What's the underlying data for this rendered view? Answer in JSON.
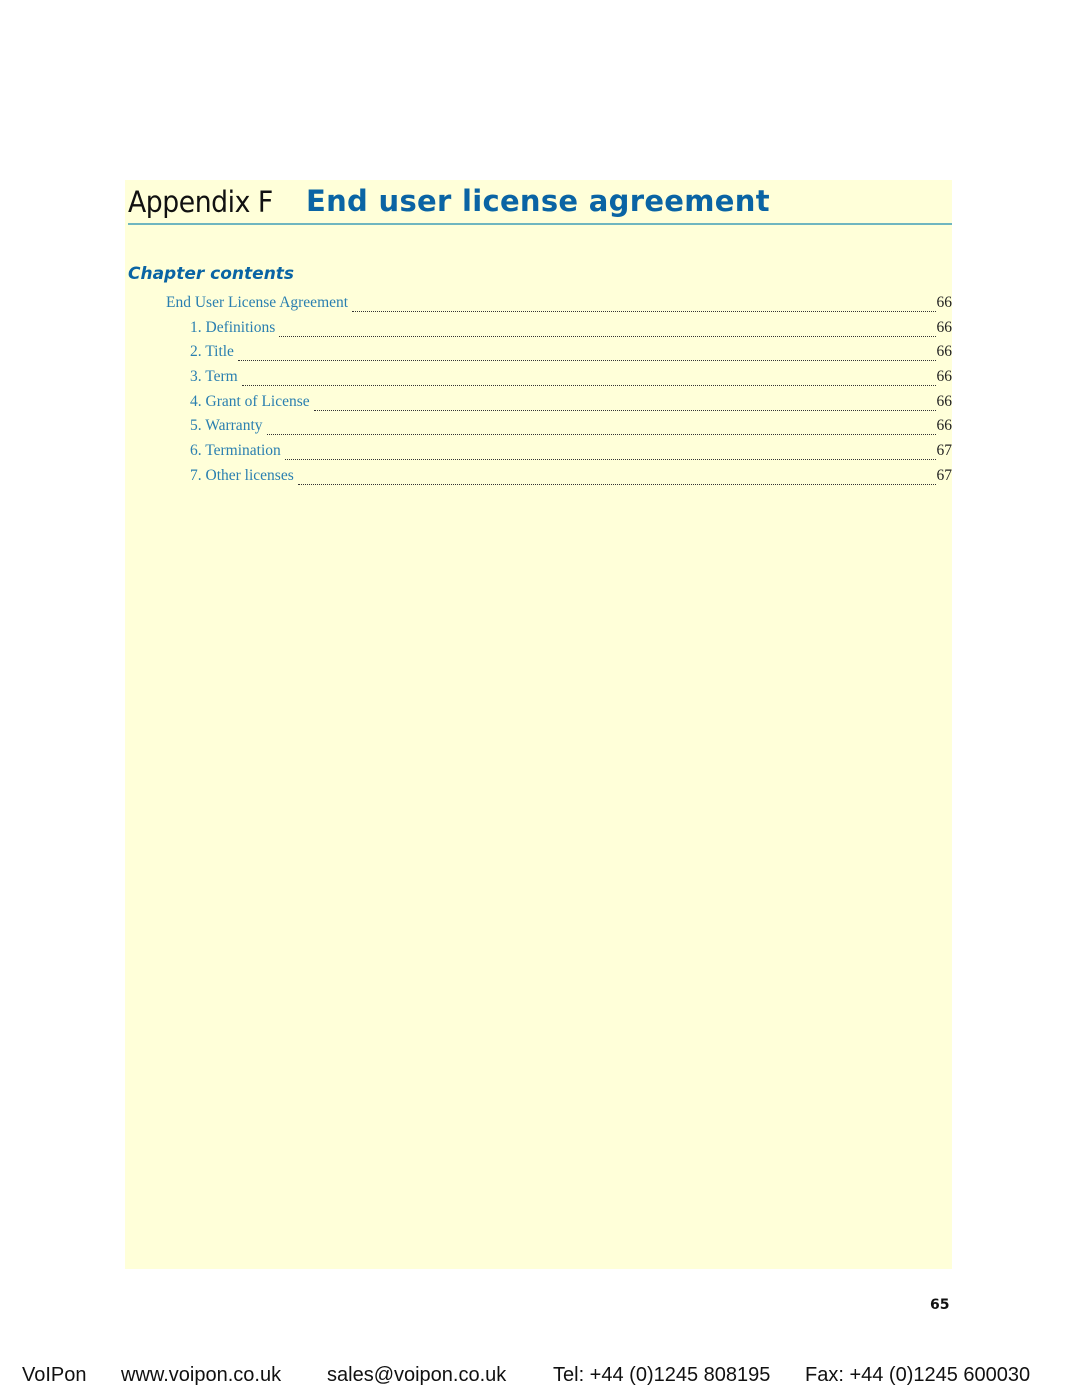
{
  "heading": {
    "prefix": "Appendix F",
    "title": "End user license agreement"
  },
  "chapter_contents": {
    "label": "Chapter contents",
    "entries": [
      {
        "label": "End User License Agreement",
        "page": "66",
        "level": 0
      },
      {
        "label": "1. Definitions",
        "page": "66",
        "level": 1
      },
      {
        "label": "2. Title",
        "page": "66",
        "level": 1
      },
      {
        "label": "3. Term",
        "page": "66",
        "level": 1
      },
      {
        "label": "4. Grant of License",
        "page": "66",
        "level": 1
      },
      {
        "label": "5. Warranty",
        "page": "66",
        "level": 1
      },
      {
        "label": "6. Termination",
        "page": "67",
        "level": 1
      },
      {
        "label": "7. Other licenses",
        "page": "67",
        "level": 1
      }
    ]
  },
  "page_number": "65",
  "footer": {
    "company": "VoIPon",
    "website": "www.voipon.co.uk",
    "email": "sales@voipon.co.uk",
    "tel": "Tel: +44 (0)1245 808195",
    "fax": "Fax: +44 (0)1245 600030"
  },
  "colors": {
    "accent": "#0a64a4",
    "link": "#2a7fb0",
    "rule": "#6fb6c0",
    "background_box": "#ffffd9"
  }
}
